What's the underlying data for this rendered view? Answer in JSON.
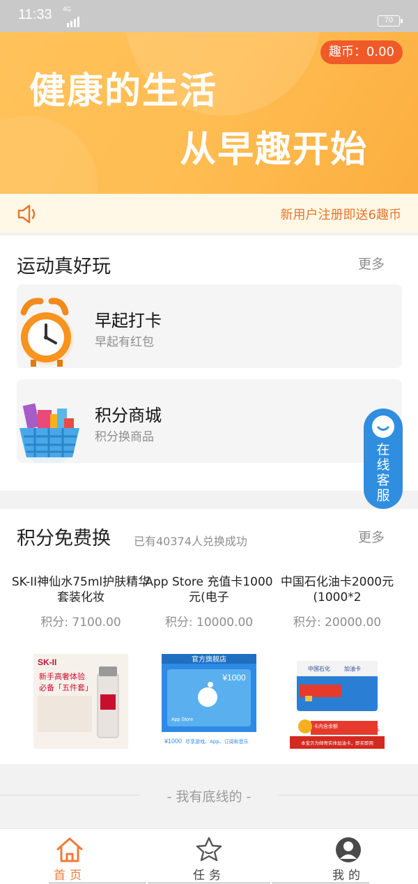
{
  "status_bar": {
    "time": "11:33",
    "network": "4G",
    "battery": "70"
  },
  "banner": {
    "line1": "健康的生活",
    "line2": "从早趣开始",
    "coin_label": "趣币：",
    "coin_value": "0.00"
  },
  "notice": {
    "text": "新用户注册即送6趣币",
    "icon": "speaker-icon"
  },
  "sports": {
    "title": "运动真好玩",
    "more": "更多",
    "cards": [
      {
        "title": "早起打卡",
        "subtitle": "早起有红包",
        "icon": "alarm-clock-icon"
      },
      {
        "title": "积分商城",
        "subtitle": "积分换商品",
        "icon": "shopping-basket-icon"
      }
    ]
  },
  "customer_service": {
    "label": "在线客服",
    "chars": [
      "在",
      "线",
      "客",
      "服"
    ],
    "icon": "smile-chat-icon"
  },
  "exchange": {
    "title": "积分免费换",
    "hint": "已有40374人兑换成功",
    "more": "更多",
    "products": [
      {
        "name": "SK-II神仙水75ml护肤精华套装化妆",
        "price": "积分: 7100.00"
      },
      {
        "name": "App Store 充值卡1000元(电子",
        "price": "积分: 10000.00"
      },
      {
        "name": "中国石化油卡2000元(1000*2",
        "price": "积分: 20000.00"
      }
    ],
    "images": {
      "skii_brand": "SK-II",
      "skii_line1": "新手高奢体验",
      "skii_line2": "必备「五件套」",
      "apple_banner": "官方旗舰店",
      "apple_amount": "¥1000",
      "apple_store": "App Store",
      "apple_footer_amount": "¥1000",
      "apple_footer_text": "尽享游戏、App、订阅和音乐",
      "sinopec_brand": "中国石化",
      "sinopec_card": "加油卡",
      "sinopec_tag": "卡内含余额",
      "sinopec_amount": "2000",
      "sinopec_unit": "元",
      "sinopec_footer": "本宝贝为邮寄实体加油卡，即买即用"
    }
  },
  "bottom_line": "- 我有底线的 -",
  "tabbar": {
    "tabs": [
      {
        "label": "首页",
        "icon": "home-icon",
        "active": true
      },
      {
        "label": "任务",
        "icon": "star-icon",
        "active": false
      },
      {
        "label": "我的",
        "icon": "user-avatar-icon",
        "active": false
      }
    ]
  },
  "colors": {
    "accent": "#f07a3a",
    "banner": "#ffbd52",
    "coin_badge": "#f05a28",
    "service": "#2f8ee0"
  }
}
